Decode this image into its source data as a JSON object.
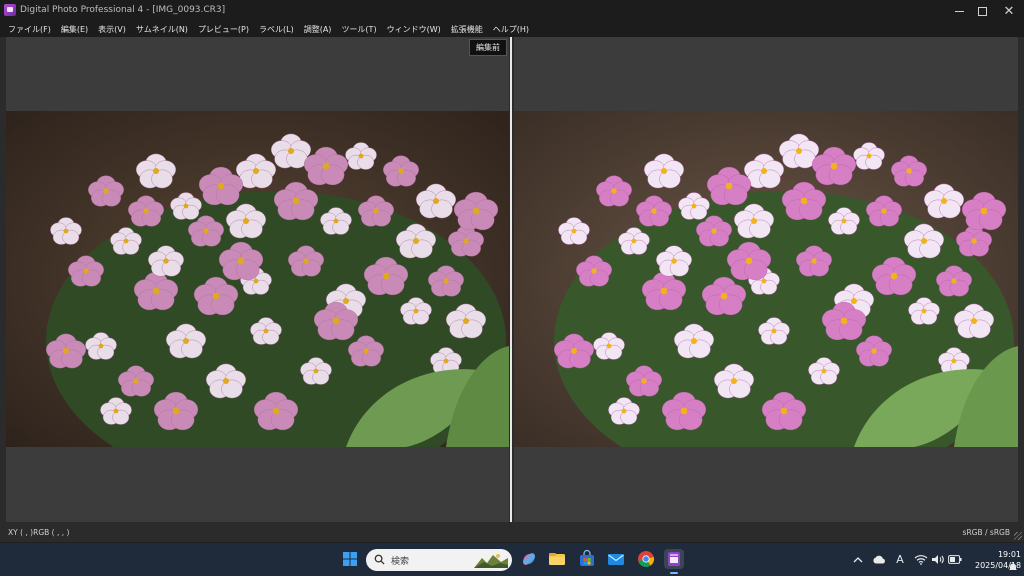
{
  "window": {
    "title": "Digital Photo Professional 4 - [IMG_0093.CR3]",
    "minimize_icon": "minimize-icon",
    "maximize_icon": "maximize-icon",
    "close_icon": "close-icon"
  },
  "menu": {
    "items": [
      "ファイル(F)",
      "編集(E)",
      "表示(V)",
      "サムネイル(N)",
      "プレビュー(P)",
      "ラベル(L)",
      "調整(A)",
      "ツール(T)",
      "ウィンドウ(W)",
      "拡張機能",
      "ヘルプ(H)"
    ]
  },
  "viewer": {
    "before_label": "編集前",
    "divider_color": "#e8e8e8"
  },
  "status": {
    "readout": "XY (    ,    )RGB (    ,    ,    )",
    "color_space": "sRGB / sRGB"
  },
  "taskbar": {
    "search_placeholder": "検索",
    "icons": [
      "windows-start-icon",
      "search-icon",
      "copilot-icon",
      "file-explorer-icon",
      "microsoft-store-icon",
      "mail-icon",
      "chrome-icon",
      "dpp-app-icon"
    ],
    "tray_icons": [
      "chevron-up-icon",
      "cloud-icon",
      "ime-icon",
      "wifi-icon",
      "speaker-icon",
      "battery-icon",
      "notification-icon"
    ],
    "ime_label": "A",
    "time": "19:01",
    "date": "2025/04/18"
  },
  "colors": {
    "accent": "#8e44c8",
    "pane_background": "#3c3c3c",
    "taskbar": "#1f2b3a"
  }
}
